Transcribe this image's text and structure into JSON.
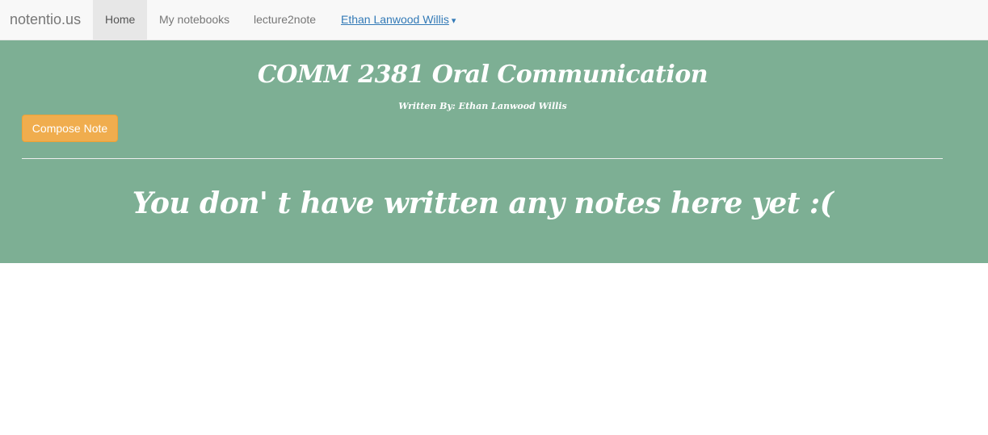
{
  "navbar": {
    "brand": "notentio.us",
    "items": [
      {
        "label": "Home",
        "active": true
      },
      {
        "label": "My notebooks",
        "active": false
      },
      {
        "label": "lecture2note",
        "active": false
      }
    ],
    "user": {
      "label": "Ethan Lanwood Willis",
      "caret": "▾"
    }
  },
  "hero": {
    "title": "COMM 2381 Oral Communication",
    "author": "Written By: Ethan Lanwood Willis",
    "compose_label": "Compose Note",
    "empty_message": "You don' t have written any notes here yet :("
  },
  "colors": {
    "hero_background": "#7daf94",
    "compose_button": "#f0ad4e",
    "link": "#337ab7"
  }
}
